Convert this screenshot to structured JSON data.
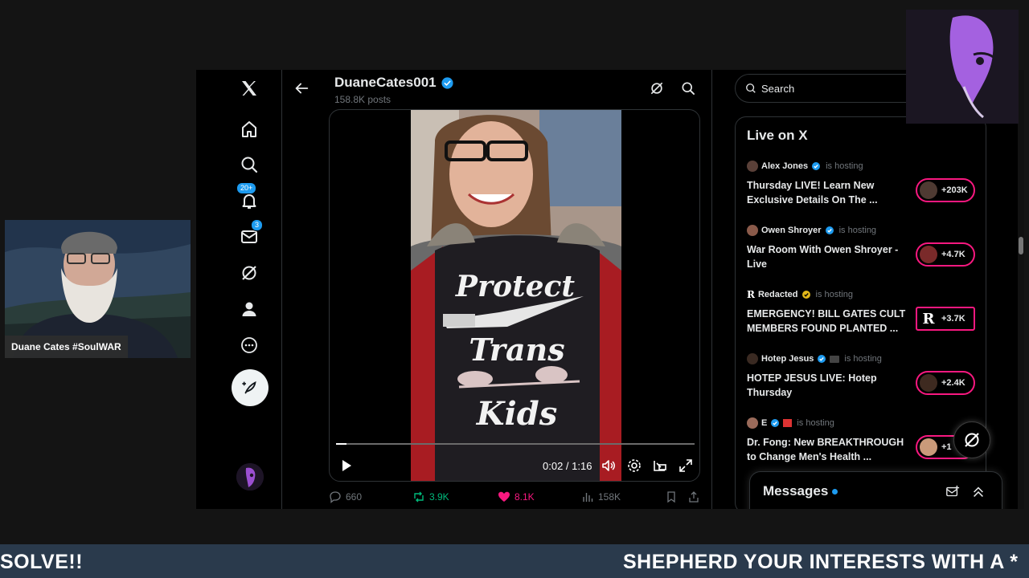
{
  "profile": {
    "name": "DuaneCates001",
    "posts": "158.8K posts"
  },
  "nav": {
    "notifications_badge": "20+",
    "messages_badge": "3"
  },
  "video": {
    "time": "0:02 / 1:16",
    "progress": 0.03,
    "shirt_text": [
      "Protect",
      "Trans",
      "Kids"
    ]
  },
  "actions": {
    "replies": "660",
    "reposts": "3.9K",
    "likes": "8.1K",
    "views": "158K"
  },
  "search": {
    "placeholder": "Search"
  },
  "live": {
    "title": "Live on X",
    "hosting_label": "is hosting",
    "items": [
      {
        "host": "Alex Jones",
        "title": "Thursday LIVE! Learn New Exclusive Details On The ...",
        "count": "+203K"
      },
      {
        "host": "Owen Shroyer",
        "title": "War Room With Owen Shroyer - Live",
        "count": "+4.7K"
      },
      {
        "host": "Redacted",
        "title": "EMERGENCY! BILL GATES CULT MEMBERS FOUND PLANTED ...",
        "count": "+3.7K"
      },
      {
        "host": "Hotep Jesus",
        "title": "HOTEP JESUS LIVE: Hotep Thursday",
        "count": "+2.4K"
      },
      {
        "host": "E",
        "title": "Dr. Fong: New BREAKTHROUGH to Change Men's Health ...",
        "count": "+1"
      }
    ]
  },
  "messages": {
    "title": "Messages"
  },
  "webcam": {
    "label": "Duane Cates #SoulWAR"
  },
  "ticker": {
    "left": "SOLVE!!",
    "right": "SHEPHERD YOUR INTERESTS WITH A *"
  },
  "colors": {
    "accent_blue": "#1d9bf0",
    "like_pink": "#f91880",
    "repost_green": "#00ba7c",
    "ticker_bg": "#2a3a4c"
  }
}
